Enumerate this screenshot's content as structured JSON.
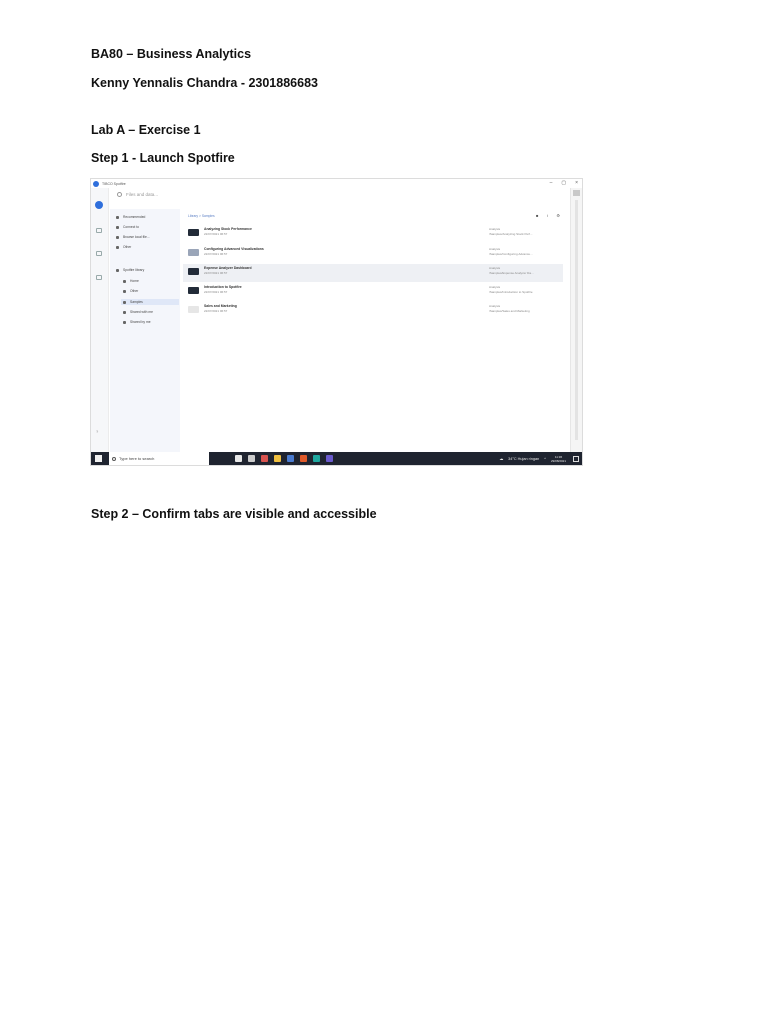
{
  "document": {
    "line1": "BA80 – Business Analytics",
    "line2": "Kenny Yennalis Chandra - 2301886683",
    "line3": "Lab A – Exercise 1",
    "line4": "Step 1 -  Launch Spotfire",
    "line5": "Step 2 – Confirm tabs are visible and accessible"
  },
  "screenshot": {
    "window_title": "TIBCO Spotfire",
    "window_controls": [
      "–",
      "▢",
      "×"
    ],
    "search_placeholder": "Files and data...",
    "nav": [
      {
        "label": "Recommended"
      },
      {
        "label": "Connect to"
      },
      {
        "label": "Browse local file..."
      },
      {
        "label": "Other"
      },
      {
        "label": "Spotfire library"
      },
      {
        "label": "Home"
      },
      {
        "label": "Other"
      },
      {
        "label": "Samples"
      },
      {
        "label": "Shared with me"
      },
      {
        "label": "Shared by me"
      }
    ],
    "breadcrumb": "Library  >  Samples",
    "rows": [
      {
        "name": "Analyzing Stock Performance",
        "date": "22/07/2021 06:57",
        "type": "Analysis",
        "path": "/Samples/Analyzing Stock Perf..."
      },
      {
        "name": "Configuring Advanced Visualizations",
        "date": "22/07/2021 06:57",
        "type": "Analysis",
        "path": "/Samples/Configuring Advance..."
      },
      {
        "name": "Expense Analyzer Dashboard",
        "date": "22/07/2021 06:57",
        "type": "Analysis",
        "path": "/Samples/Expense Analyzer Da..."
      },
      {
        "name": "Introduction to Spotfire",
        "date": "22/07/2021 06:57",
        "type": "Analysis",
        "path": "/Samples/Introduction to Spotfire"
      },
      {
        "name": "Sales and Marketing",
        "date": "22/07/2021 06:57",
        "type": "Analysis",
        "path": "/Samples/Sales and Marketing"
      }
    ],
    "taskbar": {
      "search_text": "Type here to search",
      "weather": "34°C  Hujan ringan",
      "time": "11:36",
      "date": "29/08/2021",
      "app_colors": [
        "#e8e8e8",
        "#cccccc",
        "#d9534f",
        "#f0c040",
        "#4a7bd0",
        "#e05a2a",
        "#1ea8a0",
        "#6a5acd"
      ]
    },
    "accent_color": "#2f6fdc"
  }
}
